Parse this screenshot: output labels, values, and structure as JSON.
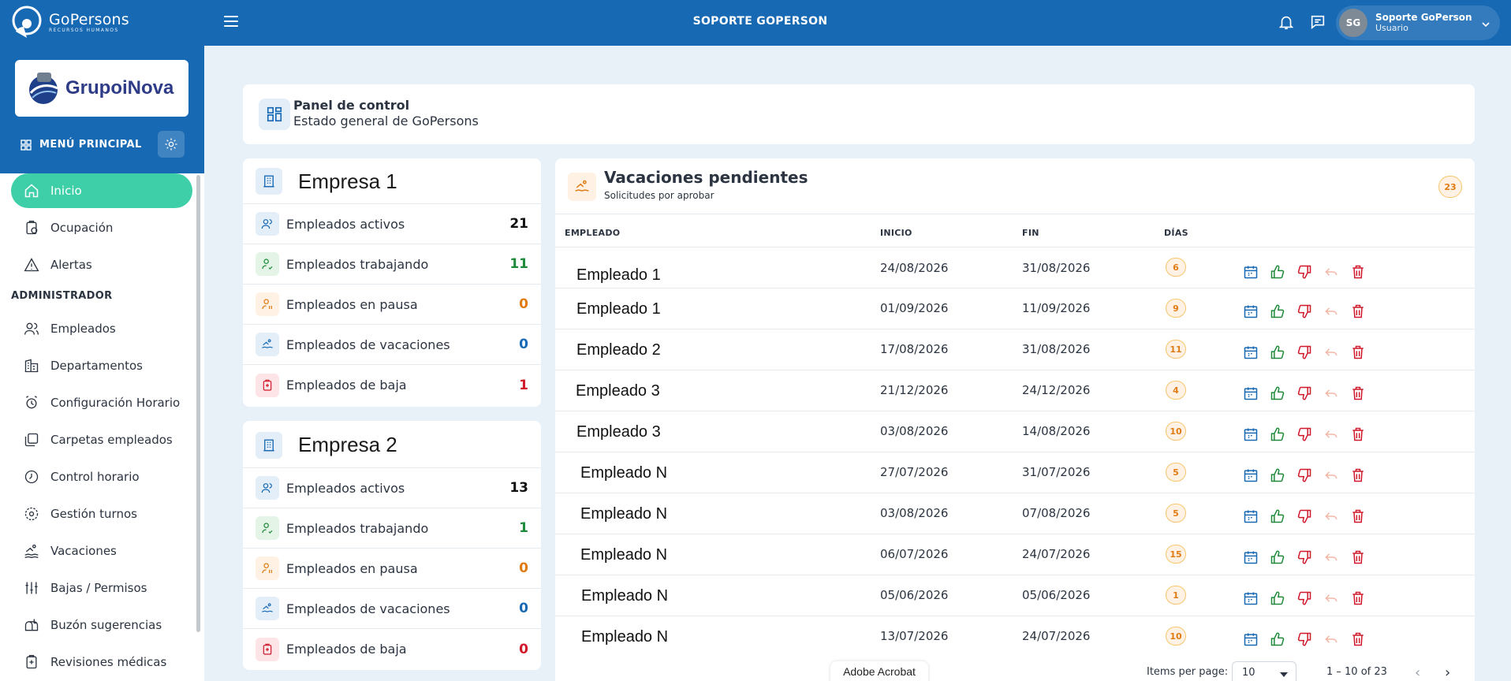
{
  "header": {
    "logo_name": "GoPersons",
    "logo_sub": "RECURSOS HUMANOS",
    "title": "SOPORTE GOPERSON",
    "user_initials": "SG",
    "user_name": "Soporte GoPerson",
    "user_role": "Usuario"
  },
  "sidebar": {
    "brand": "GrupoiNova",
    "menu_label": "MENÚ PRINCIPAL",
    "items": [
      {
        "label": "Inicio",
        "icon": "home-icon"
      },
      {
        "label": "Ocupación",
        "icon": "clipboard-icon"
      },
      {
        "label": "Alertas",
        "icon": "alert-icon"
      }
    ],
    "admin_section": "ADMINISTRADOR",
    "admin_items": [
      {
        "label": "Empleados",
        "icon": "users-icon"
      },
      {
        "label": "Departamentos",
        "icon": "building-icon"
      },
      {
        "label": "Configuración Horario",
        "icon": "alarm-icon"
      },
      {
        "label": "Carpetas empleados",
        "icon": "folders-icon"
      },
      {
        "label": "Control horario",
        "icon": "clock-icon"
      },
      {
        "label": "Gestión turnos",
        "icon": "shift-icon"
      },
      {
        "label": "Vacaciones",
        "icon": "swim-icon"
      },
      {
        "label": "Bajas / Permisos",
        "icon": "sliders-icon"
      },
      {
        "label": "Buzón sugerencias",
        "icon": "mailbox-icon"
      },
      {
        "label": "Revisiones médicas",
        "icon": "medical-icon"
      }
    ]
  },
  "panel": {
    "title": "Panel de control",
    "subtitle": "Estado general de GoPersons"
  },
  "companies": [
    {
      "name": "Empresa 1",
      "stats": [
        {
          "label": "Empleados activos",
          "value": "21"
        },
        {
          "label": "Empleados trabajando",
          "value": "11"
        },
        {
          "label": "Empleados en pausa",
          "value": "0"
        },
        {
          "label": "Empleados de vacaciones",
          "value": "0"
        },
        {
          "label": "Empleados de baja",
          "value": "1"
        }
      ]
    },
    {
      "name": "Empresa 2",
      "stats": [
        {
          "label": "Empleados activos",
          "value": "13"
        },
        {
          "label": "Empleados trabajando",
          "value": "1"
        },
        {
          "label": "Empleados en pausa",
          "value": "0"
        },
        {
          "label": "Empleados de vacaciones",
          "value": "0"
        },
        {
          "label": "Empleados de baja",
          "value": "0"
        }
      ]
    }
  ],
  "vacaciones": {
    "title": "Vacaciones pendientes",
    "subtitle": "Solicitudes por aprobar",
    "count": "23",
    "columns": [
      "EMPLEADO",
      "INICIO",
      "FIN",
      "DÍAS"
    ],
    "rows": [
      {
        "empleado": "Empleado 1",
        "inicio": "24/08/2026",
        "fin": "31/08/2026",
        "dias": "6"
      },
      {
        "empleado": "Empleado 1",
        "inicio": "01/09/2026",
        "fin": "11/09/2026",
        "dias": "9"
      },
      {
        "empleado": "Empleado 2",
        "inicio": "17/08/2026",
        "fin": "31/08/2026",
        "dias": "11"
      },
      {
        "empleado": "Empleado 3",
        "inicio": "21/12/2026",
        "fin": "24/12/2026",
        "dias": "4"
      },
      {
        "empleado": "Empleado 3",
        "inicio": "03/08/2026",
        "fin": "14/08/2026",
        "dias": "10"
      },
      {
        "empleado": "Empleado N",
        "inicio": "27/07/2026",
        "fin": "31/07/2026",
        "dias": "5"
      },
      {
        "empleado": "Empleado N",
        "inicio": "03/08/2026",
        "fin": "07/08/2026",
        "dias": "5"
      },
      {
        "empleado": "Empleado N",
        "inicio": "06/07/2026",
        "fin": "24/07/2026",
        "dias": "15"
      },
      {
        "empleado": "Empleado N",
        "inicio": "05/06/2026",
        "fin": "05/06/2026",
        "dias": "1"
      },
      {
        "empleado": "Empleado N",
        "inicio": "13/07/2026",
        "fin": "24/07/2026",
        "dias": "10"
      }
    ],
    "pager": {
      "label": "Items per page:",
      "value": "10",
      "range": "1 – 10 of 23"
    }
  },
  "overlay": {
    "acrobat": "Adobe Acrobat"
  },
  "colors": {
    "primary": "#1769b4",
    "active": "#3fcfa8",
    "positive": "#1f8a3a",
    "warning": "#e07b14",
    "info": "#1769b4",
    "danger": "#d0182a"
  }
}
